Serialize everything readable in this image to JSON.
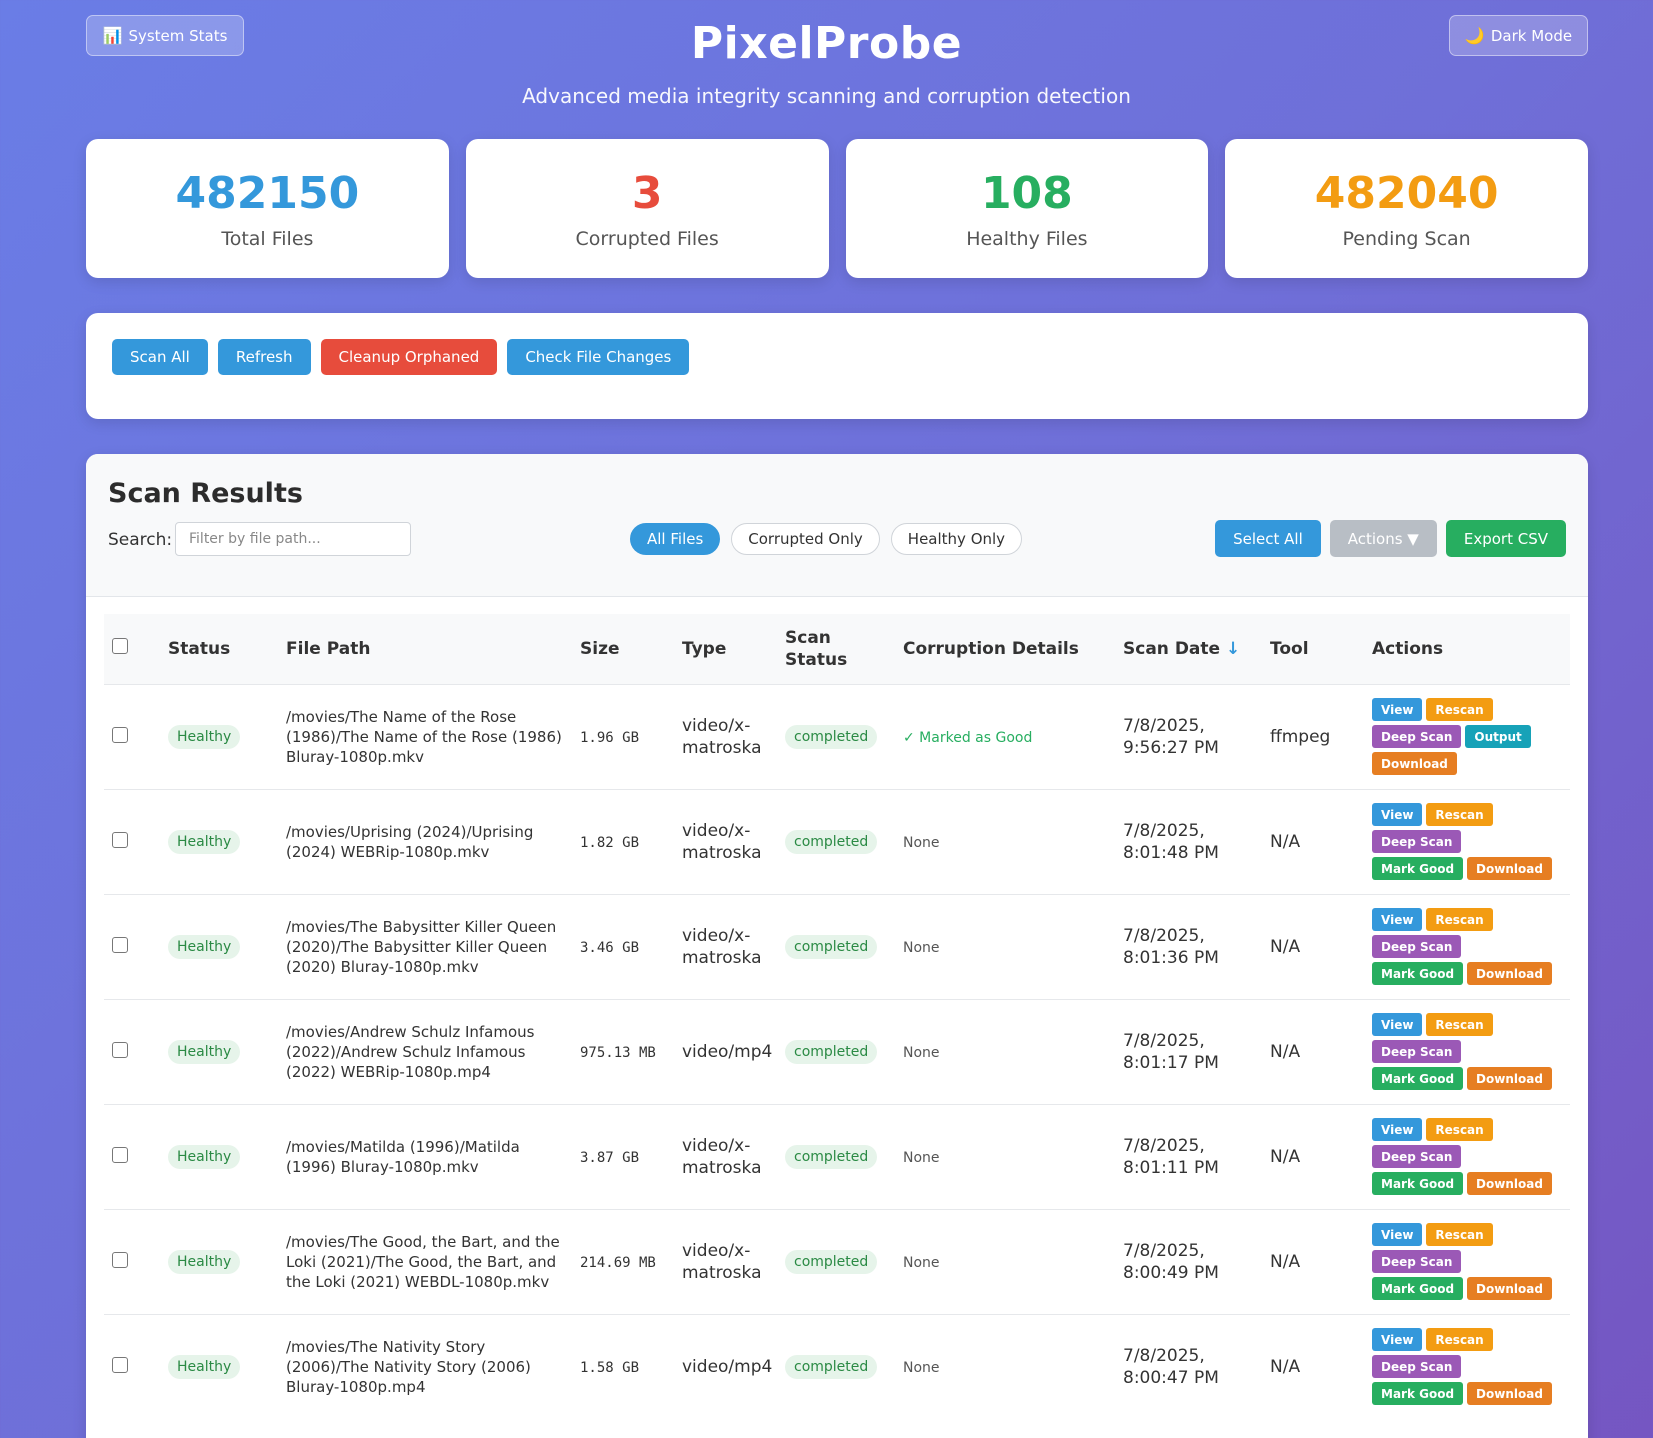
{
  "header": {
    "system_stats": "System Stats",
    "system_stats_icon": "📊",
    "dark_mode": "Dark Mode",
    "dark_mode_icon": "🌙",
    "title": "PixelProbe",
    "subtitle": "Advanced media integrity scanning and corruption detection"
  },
  "stats": [
    {
      "value": "482150",
      "label": "Total Files",
      "color": "#3498db"
    },
    {
      "value": "3",
      "label": "Corrupted Files",
      "color": "#e74c3c"
    },
    {
      "value": "108",
      "label": "Healthy Files",
      "color": "#27ae60"
    },
    {
      "value": "482040",
      "label": "Pending Scan",
      "color": "#f39c12"
    }
  ],
  "toolbar": {
    "scan_all": "Scan All",
    "refresh": "Refresh",
    "cleanup": "Cleanup Orphaned",
    "check_changes": "Check File Changes"
  },
  "results": {
    "title": "Scan Results",
    "search_label": "Search:",
    "search_placeholder": "Filter by file path...",
    "filters": [
      "All Files",
      "Corrupted Only",
      "Healthy Only"
    ],
    "select_all": "Select All",
    "actions": "Actions ▼",
    "export_csv": "Export CSV",
    "columns": {
      "status": "Status",
      "file_path": "File Path",
      "size": "Size",
      "type": "Type",
      "scan_status_1": "Scan",
      "scan_status_2": "Status",
      "corruption": "Corruption Details",
      "scan_date": "Scan Date",
      "sort_arrow": "↓",
      "tool": "Tool",
      "actions": "Actions"
    },
    "buttons": {
      "view": "View",
      "rescan": "Rescan",
      "deep_scan": "Deep Scan",
      "output": "Output",
      "mark_good": "Mark Good",
      "download": "Download"
    },
    "rows": [
      {
        "status": "Healthy",
        "path": "/movies/The Name of the Rose (1986)/The Name of the Rose (1986) Bluray-1080p.mkv",
        "size": "1.96 GB",
        "type": "video/x-matroska",
        "scan_status": "completed",
        "details": "✓ Marked as Good",
        "date1": "7/8/2025,",
        "date2": "9:56:27 PM",
        "tool": "ffmpeg",
        "marked": true
      },
      {
        "status": "Healthy",
        "path": "/movies/Uprising (2024)/Uprising (2024) WEBRip-1080p.mkv",
        "size": "1.82 GB",
        "type": "video/x-matroska",
        "scan_status": "completed",
        "details": "None",
        "date1": "7/8/2025,",
        "date2": "8:01:48 PM",
        "tool": "N/A",
        "marked": false
      },
      {
        "status": "Healthy",
        "path": "/movies/The Babysitter Killer Queen (2020)/The Babysitter Killer Queen (2020) Bluray-1080p.mkv",
        "size": "3.46 GB",
        "type": "video/x-matroska",
        "scan_status": "completed",
        "details": "None",
        "date1": "7/8/2025,",
        "date2": "8:01:36 PM",
        "tool": "N/A",
        "marked": false
      },
      {
        "status": "Healthy",
        "path": "/movies/Andrew Schulz Infamous (2022)/Andrew Schulz Infamous (2022) WEBRip-1080p.mp4",
        "size": "975.13 MB",
        "type": "video/mp4",
        "scan_status": "completed",
        "details": "None",
        "date1": "7/8/2025,",
        "date2": "8:01:17 PM",
        "tool": "N/A",
        "marked": false
      },
      {
        "status": "Healthy",
        "path": "/movies/Matilda (1996)/Matilda (1996) Bluray-1080p.mkv",
        "size": "3.87 GB",
        "type": "video/x-matroska",
        "scan_status": "completed",
        "details": "None",
        "date1": "7/8/2025,",
        "date2": "8:01:11 PM",
        "tool": "N/A",
        "marked": false
      },
      {
        "status": "Healthy",
        "path": "/movies/The Good, the Bart, and the Loki (2021)/The Good, the Bart, and the Loki (2021) WEBDL-1080p.mkv",
        "size": "214.69 MB",
        "type": "video/x-matroska",
        "scan_status": "completed",
        "details": "None",
        "date1": "7/8/2025,",
        "date2": "8:00:49 PM",
        "tool": "N/A",
        "marked": false
      },
      {
        "status": "Healthy",
        "path": "/movies/The Nativity Story (2006)/The Nativity Story (2006) Bluray-1080p.mp4",
        "size": "1.58 GB",
        "type": "video/mp4",
        "scan_status": "completed",
        "details": "None",
        "date1": "7/8/2025,",
        "date2": "8:00:47 PM",
        "tool": "N/A",
        "marked": false
      }
    ]
  }
}
